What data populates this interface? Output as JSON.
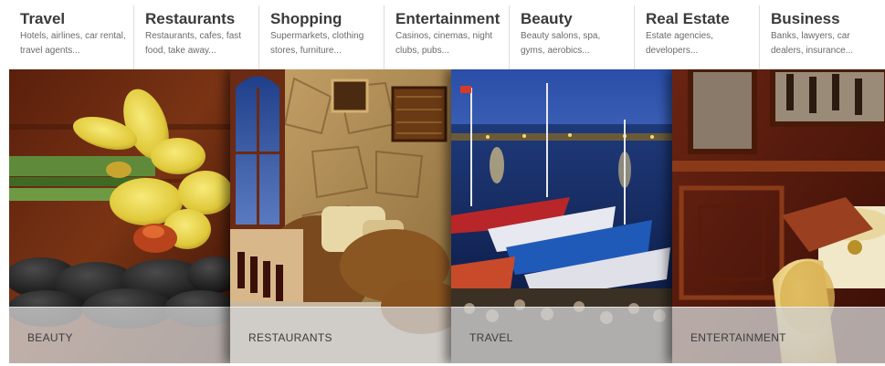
{
  "nav": {
    "items": [
      {
        "title": "Travel",
        "desc": "Hotels, airlines, car rental, travel agents..."
      },
      {
        "title": "Restaurants",
        "desc": "Restaurants, cafes, fast food, take away..."
      },
      {
        "title": "Shopping",
        "desc": "Supermarkets, clothing stores, furniture..."
      },
      {
        "title": "Entertainment",
        "desc": "Casinos, cinemas, night clubs, pubs..."
      },
      {
        "title": "Beauty",
        "desc": "Beauty salons, spa, gyms, aerobics..."
      },
      {
        "title": "Real Estate",
        "desc": "Estate agencies, developers..."
      },
      {
        "title": "Business",
        "desc": "Banks, lawyers, car dealers, insurance..."
      }
    ]
  },
  "showcase": {
    "panels": [
      {
        "caption": "BEAUTY",
        "image": "orchid-and-spa-stones-photo"
      },
      {
        "caption": "RESTAURANTS",
        "image": "restaurant-interior-photo"
      },
      {
        "caption": "TRAVEL",
        "image": "harbor-at-dusk-photo"
      },
      {
        "caption": "ENTERTAINMENT",
        "image": "casino-interior-photo"
      }
    ]
  },
  "colors": {
    "nav_title": "#3a3a3a",
    "nav_desc": "#6a6a6a",
    "caption_bar": "#d2d2d2",
    "caption_text": "#3c3c3c"
  }
}
